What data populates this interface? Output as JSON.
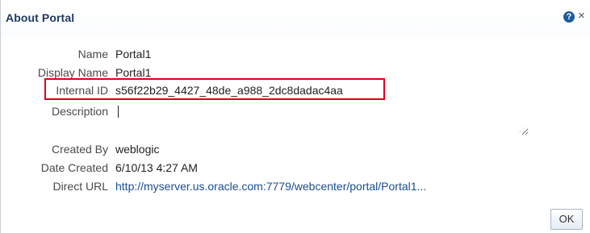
{
  "dialog": {
    "title": "About Portal"
  },
  "fields": {
    "name": {
      "label": "Name",
      "value": "Portal1"
    },
    "display_name": {
      "label": "Display Name",
      "value": "Portal1"
    },
    "internal_id": {
      "label": "Internal ID",
      "value": "s56f22b29_4427_48de_a988_2dc8dadac4aa"
    },
    "description": {
      "label": "Description",
      "value": ""
    },
    "created_by": {
      "label": "Created By",
      "value": "weblogic"
    },
    "date_created": {
      "label": "Date Created",
      "value": "6/10/13 4:27 AM"
    },
    "direct_url": {
      "label": "Direct URL",
      "value": "http://myserver.us.oracle.com:7779/webcenter/portal/Portal1..."
    }
  },
  "buttons": {
    "ok_label": "OK"
  },
  "icons": {
    "help": "question-circle-icon",
    "close": "close-icon",
    "resize": "resize-grip-icon"
  },
  "colors": {
    "title": "#1f3a63",
    "link": "#1a4d8f",
    "highlight_border": "#e0001a"
  }
}
